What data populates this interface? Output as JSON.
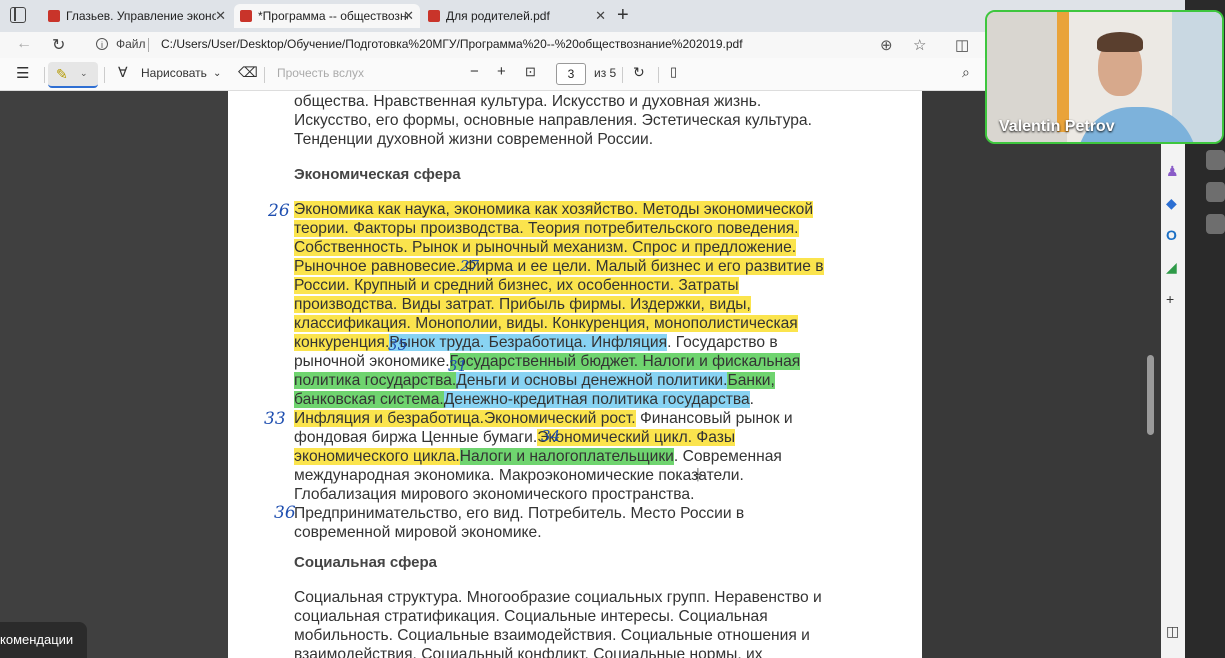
{
  "tabs": [
    {
      "title": "Глазьев. Управление экономи",
      "active": false
    },
    {
      "title": "*Программа -- обществознани",
      "active": true
    },
    {
      "title": "Для родителей.pdf",
      "active": false
    }
  ],
  "addressbar": {
    "file_label": "Файл",
    "url": "C:/Users/User/Desktop/Обучение/Подготовка%20МГУ/Программа%20--%20обществознание%202019.pdf"
  },
  "toolbar": {
    "draw_label": "Нарисовать",
    "read_aloud_label": "Прочесть вслух",
    "page_current": "3",
    "page_total": "из 5"
  },
  "document": {
    "top_lines": [
      "общества. Нравственная культура. Искусство и духовная жизнь.",
      "Искусство, его формы, основные направления. Эстетическая культура.",
      "Тенденции духовной жизни современной России."
    ],
    "section1_heading": "Экономическая сфера",
    "econ": {
      "l1": "Экономика как наука, экономика как хозяйство. Методы экономической",
      "l2": "теории. Факторы производства. Теория потребительского поведения.",
      "l3": "Собственность. Рынок и рыночный механизм. Спрос и предложение.",
      "l4": "Рыночное равновесие. Фирма и ее цели. Малый бизнес и его развитие в",
      "l5": "России. Крупный и средний бизнес, их особенности. Затраты",
      "l6": "производства. Виды затрат. Прибыль фирмы. Издержки, виды,",
      "l7": "классификация. Монополии, виды. Конкуренция, монополистическая",
      "l8a": "конкуренция.",
      "l8b": "Рынок труда. Безработица. Инфляция",
      "l8c": ". Государство в",
      "l9a": "рыночной экономике.",
      "l9b": "Государственный бюджет. Налоги и фискальная",
      "l10a": "политика государства.",
      "l10b": "Деньги и основы денежной политики.",
      "l10c": "Банки,",
      "l11a": "банковская система.",
      "l11b": "Денежно-кредитная политика государства",
      "l11c": ".",
      "l12a": "Инфляция и безработица.",
      "l12b": "Экономический рост.",
      "l12c": " Финансовый рынок и",
      "l13a": "фондовая биржа Ценные бумаги.",
      "l13b": "Экономический цикл. Фазы",
      "l14a": "экономического цикла.",
      "l14b": "Налоги и налогоплательщики",
      "l14c": ". Современная",
      "l15": "международная экономика. Макроэкономические показатели.",
      "l16": "Глобализация мирового экономического пространства.",
      "l17": "Предпринимательство, его вид. Потребитель. Место России в",
      "l18": "современной мировой экономике."
    },
    "section2_heading": "Социальная сфера",
    "social": {
      "l1": "Социальная структура. Многообразие социальных групп. Неравенство и",
      "l2": "социальная стратификация. Социальные интересы. Социальная",
      "l3": "мобильность. Социальные взаимодействия. Социальные отношения и",
      "l4": "взаимодействия. Социальный конфликт. Социальные нормы, их"
    },
    "annotations": {
      "a26": "26",
      "a27": "27",
      "a35": "35",
      "a31": "31",
      "a33": "33",
      "a34": "34",
      "a36": "36"
    }
  },
  "webcam": {
    "name": "Valentin Petrov"
  },
  "popup": {
    "text": "комендации"
  },
  "colors": {
    "highlight_yellow": "#fbe44d",
    "highlight_blue": "#88d3f3",
    "highlight_green": "#6fd46f",
    "ink": "#1f4fb0",
    "webcam_border": "#3ec63e"
  }
}
